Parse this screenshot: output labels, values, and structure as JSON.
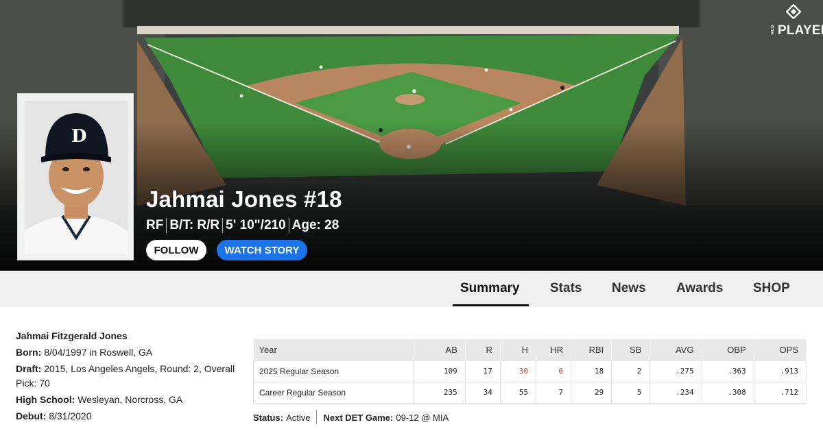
{
  "brand": {
    "logo_text": "PLAYERS",
    "league_text": "MLB"
  },
  "player": {
    "name_number": "Jahmai Jones #18",
    "position": "RF",
    "bats_throws": "B/T: R/R",
    "height_weight": "5' 10\"/210",
    "age": "Age: 28"
  },
  "actions": {
    "follow_label": "FOLLOW",
    "watch_label": "WATCH STORY"
  },
  "tabs": [
    {
      "label": "Summary",
      "active": true
    },
    {
      "label": "Stats",
      "active": false
    },
    {
      "label": "News",
      "active": false
    },
    {
      "label": "Awards",
      "active": false
    },
    {
      "label": "SHOP",
      "active": false
    }
  ],
  "bio": {
    "full_name": "Jahmai Fitzgerald Jones",
    "born_label": "Born:",
    "born_value": "8/04/1997 in Roswell, GA",
    "draft_label": "Draft:",
    "draft_value": "2015, Los Angeles Angels, Round: 2, Overall Pick: 70",
    "school_label": "High School:",
    "school_value": "Wesleyan, Norcross, GA",
    "debut_label": "Debut:",
    "debut_value": "8/31/2020"
  },
  "stats_table": {
    "headers": [
      "Year",
      "AB",
      "R",
      "H",
      "HR",
      "RBI",
      "SB",
      "AVG",
      "OBP",
      "OPS"
    ],
    "rows": [
      {
        "cells": [
          "2025 Regular Season",
          "109",
          "17",
          "30",
          "6",
          "18",
          "2",
          ".275",
          ".363",
          ".913"
        ]
      },
      {
        "cells": [
          "Career Regular Season",
          "235",
          "34",
          "55",
          "7",
          "29",
          "5",
          ".234",
          ".308",
          ".712"
        ]
      }
    ],
    "highlight_color": "#c0392b"
  },
  "status": {
    "status_label": "Status:",
    "status_value": "Active",
    "next_label": "Next DET Game:",
    "next_value": "09-12 @ MIA"
  },
  "colors": {
    "accent_blue": "#1a73e8",
    "hero_dark": "#111111",
    "tab_bar": "#f0f0f0"
  }
}
